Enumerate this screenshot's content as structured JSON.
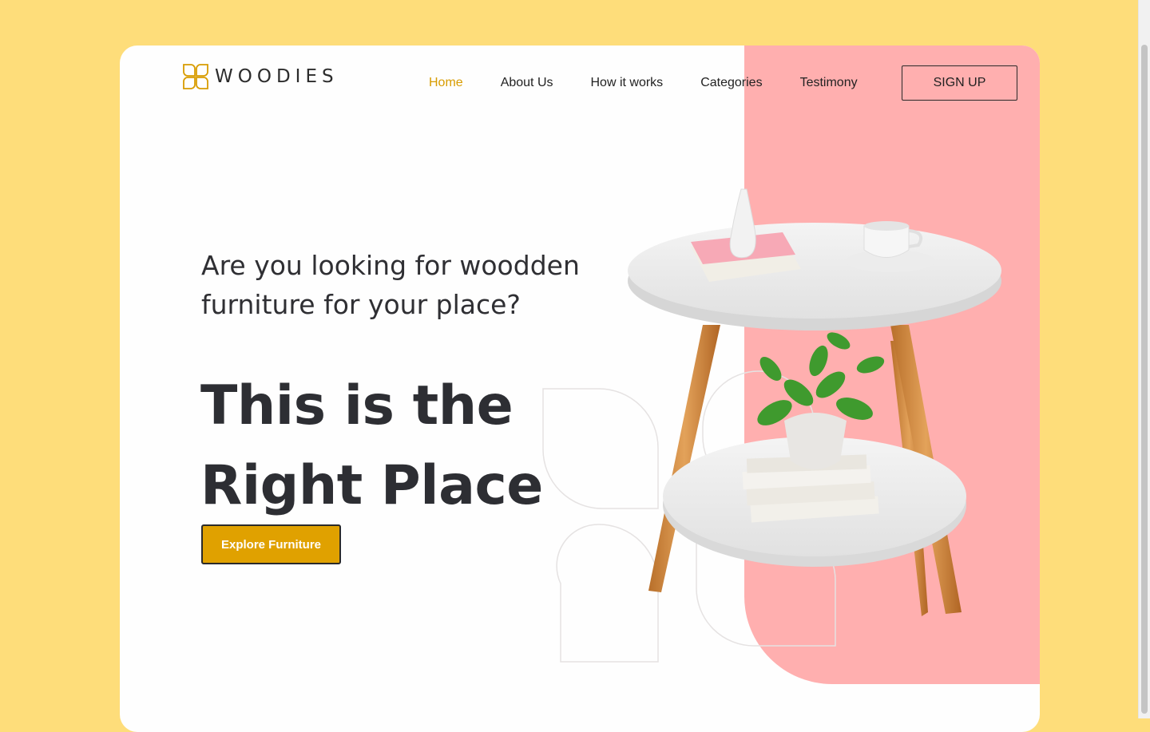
{
  "brand": {
    "name": "WOODIES",
    "accent": "#D89C00",
    "background": "#FEDD7A",
    "panel": "#FFAFAF"
  },
  "nav": {
    "items": [
      {
        "label": "Home",
        "active": true
      },
      {
        "label": "About Us",
        "active": false
      },
      {
        "label": "How it works",
        "active": false
      },
      {
        "label": "Categories",
        "active": false
      },
      {
        "label": "Testimony",
        "active": false
      }
    ],
    "signup_label": "SIGN UP"
  },
  "hero": {
    "subtitle_line1": "Are you looking for woodden",
    "subtitle_line2": "furniture for your place?",
    "headline_line1": "This is the",
    "headline_line2": "Right Place",
    "cta_label": "Explore Furniture"
  },
  "icons": {
    "logo": "leaf-logo-icon",
    "product": "side-table-image"
  }
}
